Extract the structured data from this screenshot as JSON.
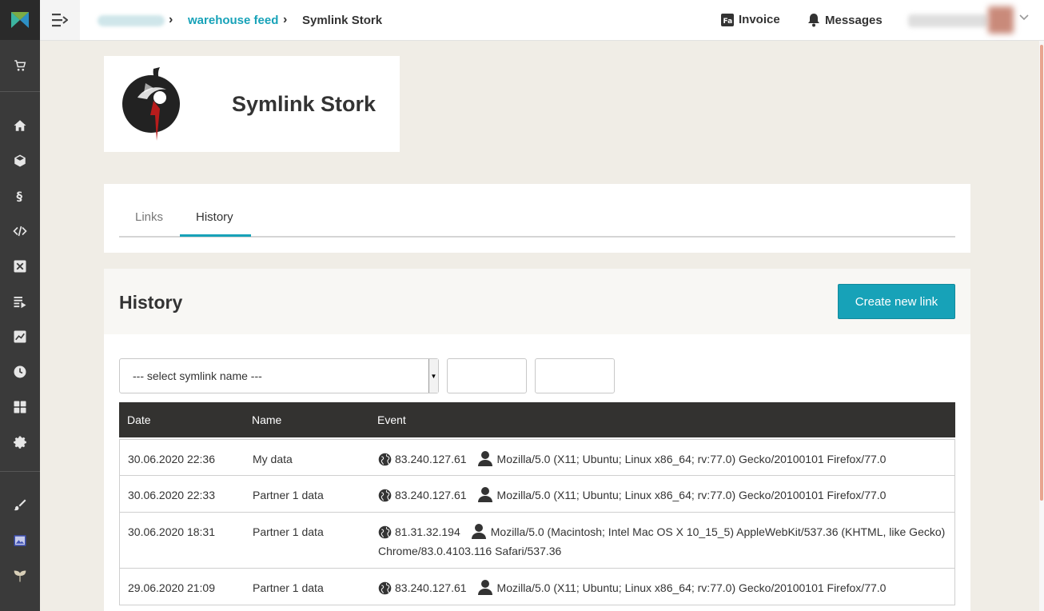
{
  "topbar": {
    "breadcrumb_link": "warehouse feed",
    "breadcrumb_current": "Symlink Stork",
    "invoice_label": "Invoice",
    "messages_label": "Messages"
  },
  "header": {
    "title": "Symlink Stork"
  },
  "tabs": [
    {
      "label": "Links",
      "active": false
    },
    {
      "label": "History",
      "active": true
    }
  ],
  "history": {
    "title": "History",
    "create_button": "Create new link",
    "select_placeholder": "--- select symlink name ---",
    "columns": [
      "Date",
      "Name",
      "Event"
    ],
    "rows": [
      {
        "date": "30.06.2020 22:36",
        "name": "My data",
        "ip": "83.240.127.61",
        "agent": "Mozilla/5.0 (X11; Ubuntu; Linux x86_64; rv:77.0) Gecko/20100101 Firefox/77.0"
      },
      {
        "date": "30.06.2020 22:33",
        "name": "Partner 1 data",
        "ip": "83.240.127.61",
        "agent": "Mozilla/5.0 (X11; Ubuntu; Linux x86_64; rv:77.0) Gecko/20100101 Firefox/77.0"
      },
      {
        "date": "30.06.2020 18:31",
        "name": "Partner 1 data",
        "ip": "81.31.32.194",
        "agent": "Mozilla/5.0 (Macintosh; Intel Mac OS X 10_15_5) AppleWebKit/537.36 (KHTML, like Gecko) Chrome/83.0.4103.116 Safari/537.36"
      },
      {
        "date": "29.06.2020 21:09",
        "name": "Partner 1 data",
        "ip": "83.240.127.61",
        "agent": "Mozilla/5.0 (X11; Ubuntu; Linux x86_64; rv:77.0) Gecko/20100101 Firefox/77.0"
      }
    ]
  },
  "sidebar": {
    "icons": [
      "cart-icon",
      "home-icon",
      "box-icon",
      "section-icon",
      "code-icon",
      "excel-icon",
      "playlist-icon",
      "chart-icon",
      "clock-icon",
      "apps-icon",
      "gear-icon",
      "brush-icon",
      "image-icon",
      "plant-icon"
    ]
  },
  "colors": {
    "accent": "#17a2b8",
    "sidebar": "#3a3a3a",
    "table_header": "#333230",
    "page_bg": "#f0ede6"
  }
}
